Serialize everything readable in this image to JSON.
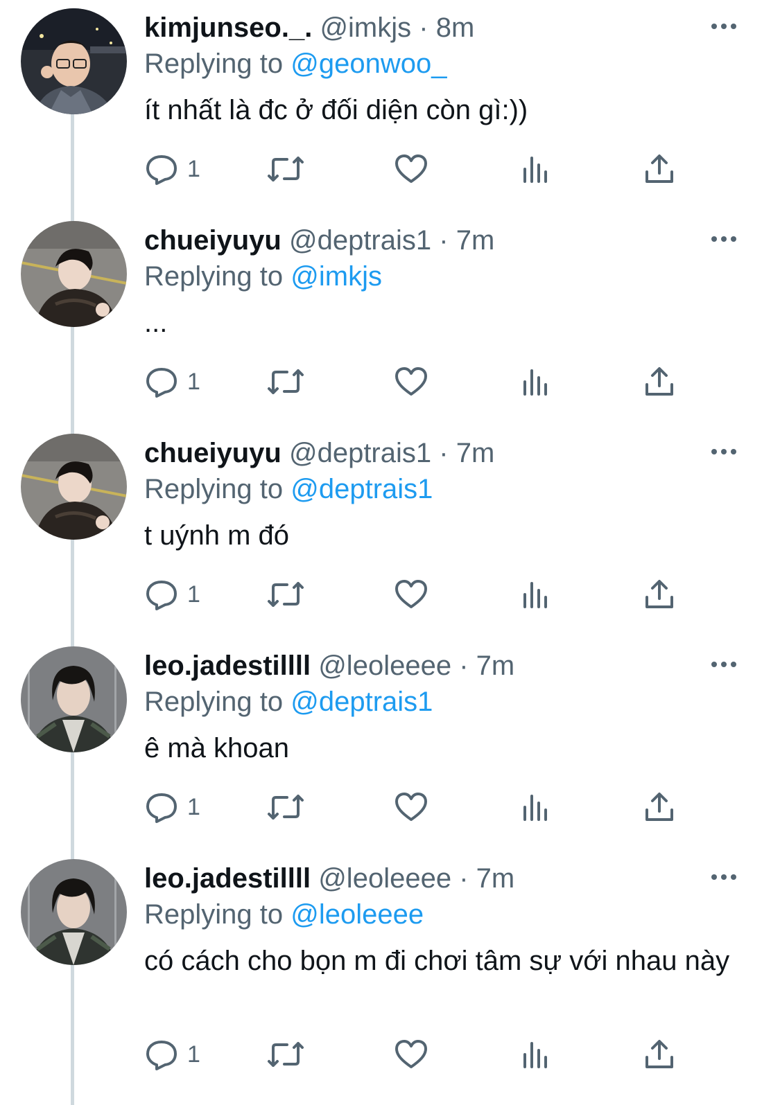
{
  "colors": {
    "text": "#0f1419",
    "secondary": "#536471",
    "link": "#1d9bf0",
    "thread_line": "#cfd9de"
  },
  "tweets": [
    {
      "display_name": "kimjunseo._.",
      "handle": "@imkjs",
      "separator": "·",
      "time": "8m",
      "replying_prefix": "Replying to",
      "replying_to": "@geonwoo_",
      "text": "ít nhất là đc ở đối diện còn gì:))",
      "reply_count": "1",
      "avatar_icon": "avatar-photo-glasses"
    },
    {
      "display_name": "chueiyuyu",
      "handle": "@deptrais1",
      "separator": "·",
      "time": "7m",
      "replying_prefix": "Replying to",
      "replying_to": "@imkjs",
      "text": "...",
      "reply_count": "1",
      "avatar_icon": "avatar-photo-street"
    },
    {
      "display_name": "chueiyuyu",
      "handle": "@deptrais1",
      "separator": "·",
      "time": "7m",
      "replying_prefix": "Replying to",
      "replying_to": "@deptrais1",
      "text": "t uýnh m đó",
      "reply_count": "1",
      "avatar_icon": "avatar-photo-street"
    },
    {
      "display_name": "leo.jadestillll",
      "handle": "@leoleeee",
      "separator": "·",
      "time": "7m",
      "replying_prefix": "Replying to",
      "replying_to": "@deptrais1",
      "text": "ê mà khoan",
      "reply_count": "1",
      "avatar_icon": "avatar-photo-jacket"
    },
    {
      "display_name": "leo.jadestillll",
      "handle": "@leoleeee",
      "separator": "·",
      "time": "7m",
      "replying_prefix": "Replying to",
      "replying_to": "@leoleeee",
      "text": "có cách cho bọn m đi chơi tâm sự với nhau này",
      "reply_count": "1",
      "avatar_icon": "avatar-photo-jacket"
    }
  ],
  "action_icons": [
    "reply-icon",
    "retweet-icon",
    "like-icon",
    "views-icon",
    "share-icon"
  ]
}
